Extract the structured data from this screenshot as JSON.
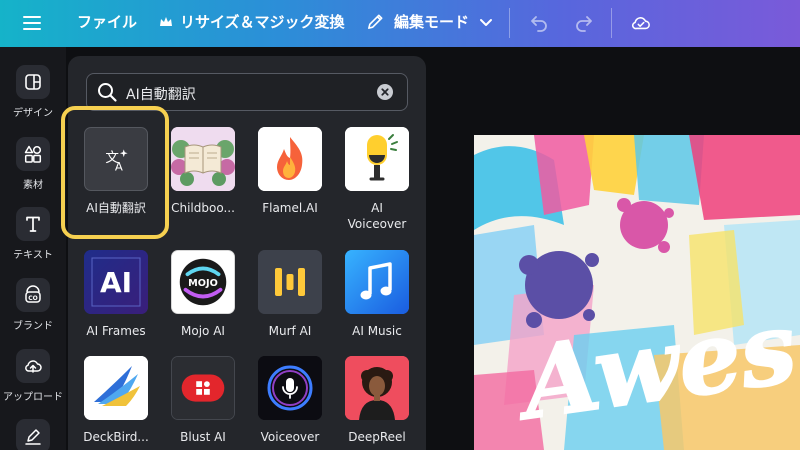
{
  "topbar": {
    "file_label": "ファイル",
    "resize_label": "リサイズ＆マジック変換",
    "edit_mode_label": "編集モード",
    "gradient_colors": [
      "#15b3c9",
      "#2c8ed8",
      "#5767dd",
      "#7a5ad9"
    ]
  },
  "rail": {
    "items": [
      {
        "label": "デザイン",
        "icon": "layout-icon"
      },
      {
        "label": "素材",
        "icon": "shapes-icon"
      },
      {
        "label": "テキスト",
        "icon": "text-icon"
      },
      {
        "label": "ブランド",
        "icon": "brand-icon"
      },
      {
        "label": "アップロード",
        "icon": "upload-icon"
      }
    ]
  },
  "panel": {
    "search": {
      "value": "AI自動翻訳"
    },
    "apps": [
      {
        "name": "AI自動翻訳",
        "icon": "translate-icon",
        "selected": true
      },
      {
        "name": "Childboo...",
        "icon": "book-icon"
      },
      {
        "name": "Flamel.AI",
        "icon": "flame-icon"
      },
      {
        "name_line1": "AI",
        "name_line2": "Voiceover",
        "icon": "microphone-icon"
      },
      {
        "name": "AI Frames",
        "icon": "ai-frames-icon"
      },
      {
        "name": "Mojo AI",
        "icon": "mojo-icon"
      },
      {
        "name": "Murf AI",
        "icon": "murf-icon"
      },
      {
        "name": "AI Music",
        "icon": "music-note-icon"
      },
      {
        "name": "DeckBird...",
        "icon": "deckbird-icon"
      },
      {
        "name": "Blust AI",
        "icon": "blust-icon"
      },
      {
        "name": "Voiceover",
        "icon": "voiceover-mic-icon"
      },
      {
        "name": "DeepReel",
        "icon": "avatar-icon"
      }
    ],
    "tile_labels": {
      "ai_frames": "AI",
      "mojo": "MOJO"
    },
    "highlight_color": "#f6d050"
  },
  "canvas": {
    "design_text": "Awes"
  }
}
